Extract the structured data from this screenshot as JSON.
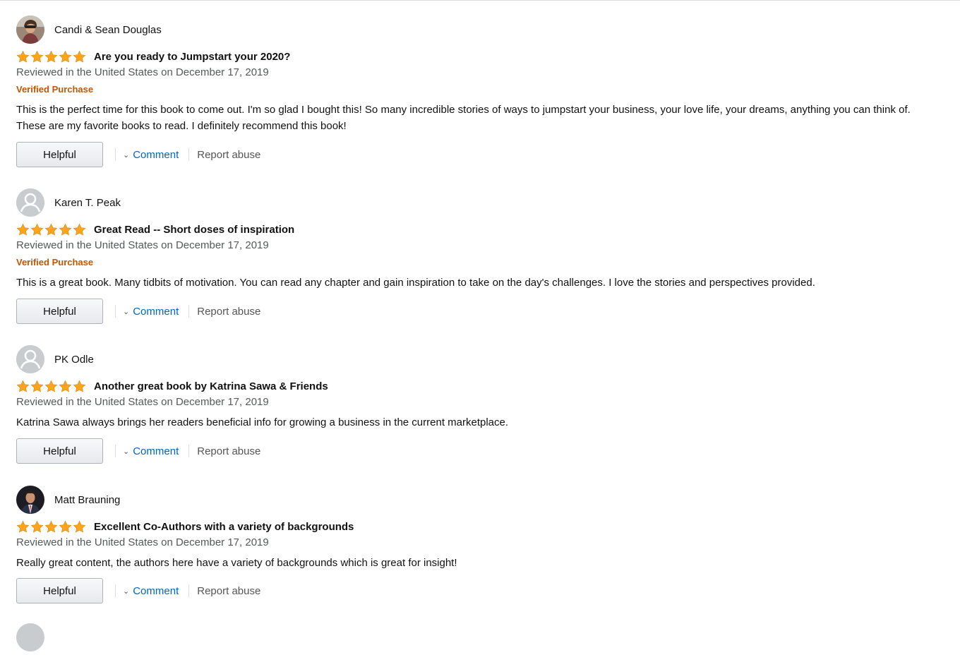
{
  "reviews": [
    {
      "author": "Candi & Sean Douglas",
      "avatar": "user-photo-woman",
      "rating": 5,
      "title": "Are you ready to Jumpstart your 2020?",
      "date": "Reviewed in the United States on December 17, 2019",
      "verified": "Verified Purchase",
      "body": "This is the perfect time for this book to come out. I'm so glad I bought this! So many incredible stories of ways to jumpstart your business, your love life, your dreams, anything you can think of. These are my favorite books to read. I definitely recommend this book!",
      "helpful_label": "Helpful",
      "comment_label": "Comment",
      "report_label": "Report abuse"
    },
    {
      "author": "Karen T. Peak",
      "avatar": "default-user-icon",
      "rating": 5,
      "title": "Great Read -- Short doses of inspiration",
      "date": "Reviewed in the United States on December 17, 2019",
      "verified": "Verified Purchase",
      "body": "This is a great book. Many tidbits of motivation. You can read any chapter and gain inspiration to take on the day's challenges. I love the stories and perspectives provided.",
      "helpful_label": "Helpful",
      "comment_label": "Comment",
      "report_label": "Report abuse"
    },
    {
      "author": "PK Odle",
      "avatar": "default-user-icon",
      "rating": 5,
      "title": "Another great book by Katrina Sawa & Friends",
      "date": "Reviewed in the United States on December 17, 2019",
      "verified": "",
      "body": "Katrina Sawa always brings her readers beneficial info for growing a business in the current marketplace.",
      "helpful_label": "Helpful",
      "comment_label": "Comment",
      "report_label": "Report abuse"
    },
    {
      "author": "Matt Brauning",
      "avatar": "user-photo-man",
      "rating": 5,
      "title": "Excellent Co-Authors with a variety of backgrounds",
      "date": "Reviewed in the United States on December 17, 2019",
      "verified": "",
      "body": "Really great content, the authors here have a variety of backgrounds which is great for insight!",
      "helpful_label": "Helpful",
      "comment_label": "Comment",
      "report_label": "Report abuse"
    }
  ],
  "colors": {
    "star": "#ffa41c",
    "verified": "#c45500",
    "link": "#0066c0",
    "muted": "#565959"
  }
}
